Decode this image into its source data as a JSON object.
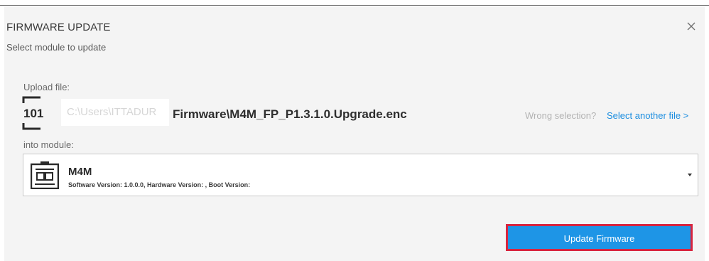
{
  "dialog": {
    "title": "FIRMWARE UPDATE",
    "subtitle": "Select module to update",
    "close_glyph": "×"
  },
  "upload": {
    "label": "Upload file:",
    "icon": "binary-file-icon",
    "icon_text": "101",
    "path_prefix_obscured": "C:\\Users\\ITTADUR",
    "file_path": "Firmware\\M4M_FP_P1.3.1.0.Upgrade.enc",
    "wrong_selection_text": "Wrong selection?",
    "select_another_label": "Select another file >"
  },
  "module": {
    "label": "into module:",
    "icon": "module-device-icon",
    "selected_name": "M4M",
    "selected_details": "Software Version: 1.0.0.0, Hardware Version: , Boot Version:"
  },
  "actions": {
    "update_label": "Update Firmware"
  },
  "colors": {
    "accent": "#1e95e6",
    "highlight_border": "#d8253f",
    "link": "#1a8de0",
    "dialog_bg": "#f4f4f4"
  }
}
